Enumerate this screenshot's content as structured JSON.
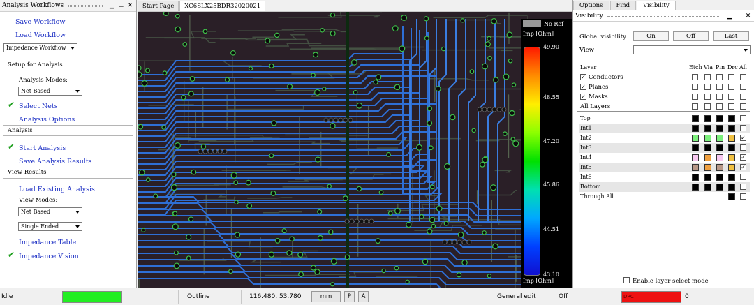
{
  "left_panel": {
    "title": "Analysis Workflows",
    "save_workflow": "Save Workflow",
    "load_workflow": "Load Workflow",
    "workflow_select": "Impedance Workflow",
    "setup_heading": "Setup for Analysis",
    "analysis_modes_label": "Analysis Modes:",
    "analysis_mode_select": "Net Based",
    "select_nets": "Select Nets",
    "analysis_options": "Analysis Options",
    "analysis_heading": "Analysis",
    "start_analysis": "Start Analysis",
    "save_results": "Save Analysis Results",
    "view_results_heading": "View Results",
    "load_existing": "Load Existing Analysis",
    "view_modes_label": "View Modes:",
    "view_mode_select": "Net Based",
    "ended_select": "Single Ended",
    "impedance_table": "Impedance Table",
    "impedance_vision": "Impedance Vision"
  },
  "center": {
    "tabs": [
      "Start Page",
      "XC6SLX25BDR32020021"
    ],
    "active_tab": 1,
    "legend": {
      "no_ref": "No Ref",
      "unit_top": "Imp [Ohm]",
      "unit_bottom": "Imp [Ohm]",
      "ticks": [
        "49.90",
        "48.55",
        "47.20",
        "45.86",
        "44.51",
        "43.10"
      ]
    }
  },
  "right_panel": {
    "tabs": [
      "Options",
      "Find",
      "Visibility"
    ],
    "active_tab": 2,
    "title": "Visibility",
    "global_label": "Global visibility",
    "on_label": "On",
    "off_label": "Off",
    "last_label": "Last",
    "view_label": "View",
    "headers": {
      "layer": "Layer",
      "etch": "Etch",
      "via": "Via",
      "pin": "Pin",
      "drc": "Drc",
      "all": "All"
    },
    "groups": [
      {
        "name": "Conductors",
        "checked": true
      },
      {
        "name": "Planes",
        "checked": true
      },
      {
        "name": "Masks",
        "checked": true
      },
      {
        "name": "All Layers",
        "checked": false
      }
    ],
    "layers": [
      {
        "name": "Top",
        "colors": [
          "#000000",
          "#000000",
          "#000000",
          "#000000"
        ],
        "all": false
      },
      {
        "name": "Int1",
        "colors": [
          "#000000",
          "#000000",
          "#000000",
          "#000000"
        ],
        "all": false
      },
      {
        "name": "Int2",
        "colors": [
          "#7cf07c",
          "#7cf07c",
          "#7cf07c",
          "#f0c040"
        ],
        "all": true
      },
      {
        "name": "Int3",
        "colors": [
          "#000000",
          "#000000",
          "#000000",
          "#000000"
        ],
        "all": false
      },
      {
        "name": "Int4",
        "colors": [
          "#f8c8f0",
          "#f0a040",
          "#f8c8f0",
          "#f0c040"
        ],
        "all": true
      },
      {
        "name": "Int5",
        "colors": [
          "#b89888",
          "#f0a040",
          "#b89888",
          "#f0c040"
        ],
        "all": true
      },
      {
        "name": "Int6",
        "colors": [
          "#000000",
          "#000000",
          "#000000",
          "#000000"
        ],
        "all": false
      },
      {
        "name": "Bottom",
        "colors": [
          "#000000",
          "#000000",
          "#000000",
          "#000000"
        ],
        "all": false
      },
      {
        "name": "Through All",
        "colors": [
          null,
          null,
          null,
          "#000000"
        ],
        "all": false
      }
    ],
    "enable_layer_select": "Enable layer select mode"
  },
  "status_bar": {
    "state": "Idle",
    "mode": "Outline",
    "coords": "116.480, 53.780",
    "units": "mm",
    "p_btn": "P",
    "a_btn": "A",
    "edit_mode": "General edit",
    "off": "Off",
    "drc_label": "DRC",
    "drc_count": "0",
    "colors": {
      "idle_indicator": "#22ee22",
      "drc_indicator": "#ee1111"
    }
  }
}
